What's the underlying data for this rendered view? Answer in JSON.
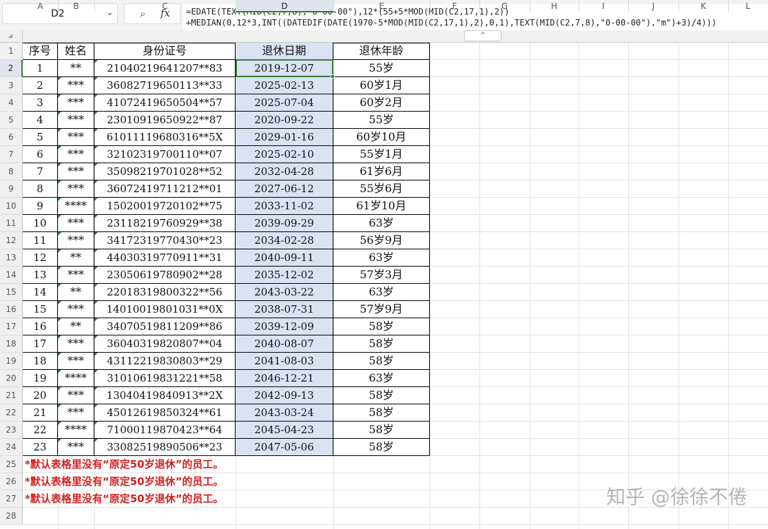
{
  "name_box": "D2",
  "formula_bar": {
    "zoom_icon": "zoom-search-icon",
    "fx_label": "fx",
    "line1": "=EDATE(TEXT(MID(C2,7,8),\"0-00-00\"),12*(55+5*MOD(MID(C2,17,1),2))",
    "line2": "+MEDIAN(0,12*3,INT((DATEDIF(DATE(1970-5*MOD(MID(C2,17,1),2),0,1),TEXT(MID(C2,7,8),\"0-00-00\"),\"m\")+3)/4)))"
  },
  "columns": [
    "A",
    "B",
    "C",
    "D",
    "E",
    "F",
    "G",
    "H",
    "I",
    "J",
    "K",
    "L"
  ],
  "selected_column": "D",
  "selected_row": 2,
  "collapse_label": "^",
  "headers": [
    "序号",
    "姓名",
    "身份证号",
    "退休日期",
    "退休年龄"
  ],
  "rows": [
    [
      "1",
      "**",
      "21040219641207**83",
      "2019-12-07",
      "55岁"
    ],
    [
      "2",
      "***",
      "36082719650113**33",
      "2025-02-13",
      "60岁1月"
    ],
    [
      "3",
      "***",
      "41072419650504**57",
      "2025-07-04",
      "60岁2月"
    ],
    [
      "4",
      "***",
      "23010919650922**87",
      "2020-09-22",
      "55岁"
    ],
    [
      "5",
      "***",
      "61011119680316**5X",
      "2029-01-16",
      "60岁10月"
    ],
    [
      "6",
      "***",
      "32102319700110**07",
      "2025-02-10",
      "55岁1月"
    ],
    [
      "7",
      "***",
      "35098219701028**52",
      "2032-04-28",
      "61岁6月"
    ],
    [
      "8",
      "***",
      "36072419711212**01",
      "2027-06-12",
      "55岁6月"
    ],
    [
      "9",
      "****",
      "15020019720102**75",
      "2033-11-02",
      "61岁10月"
    ],
    [
      "10",
      "***",
      "23118219760929**38",
      "2039-09-29",
      "63岁"
    ],
    [
      "11",
      "***",
      "34172319770430**23",
      "2034-02-28",
      "56岁9月"
    ],
    [
      "12",
      "**",
      "44030319770911**31",
      "2040-09-11",
      "63岁"
    ],
    [
      "13",
      "***",
      "23050619780902**28",
      "2035-12-02",
      "57岁3月"
    ],
    [
      "14",
      "**",
      "22018319800322**56",
      "2043-03-22",
      "63岁"
    ],
    [
      "15",
      "***",
      "14010019801031**0X",
      "2038-07-31",
      "57岁9月"
    ],
    [
      "16",
      "**",
      "34070519811209**86",
      "2039-12-09",
      "58岁"
    ],
    [
      "17",
      "***",
      "36040319820807**04",
      "2040-08-07",
      "58岁"
    ],
    [
      "18",
      "***",
      "43112219830803**29",
      "2041-08-03",
      "58岁"
    ],
    [
      "19",
      "****",
      "31010619831221**58",
      "2046-12-21",
      "63岁"
    ],
    [
      "20",
      "***",
      "13040419840913**2X",
      "2042-09-13",
      "58岁"
    ],
    [
      "21",
      "***",
      "45012619850324**61",
      "2043-03-24",
      "58岁"
    ],
    [
      "22",
      "****",
      "71000119870423**64",
      "2045-04-23",
      "58岁"
    ],
    [
      "23",
      "***",
      "33082519890506**23",
      "2047-05-06",
      "58岁"
    ]
  ],
  "notes": [
    "*默认表格里没有“原定50岁退休”的员工。",
    "*默认表格里没有“原定50岁退休”的员工。",
    "*默认表格里没有“原定50岁退休”的员工。"
  ],
  "row_numbers": [
    "1",
    "2",
    "3",
    "4",
    "5",
    "6",
    "7",
    "8",
    "9",
    "10",
    "11",
    "12",
    "13",
    "14",
    "15",
    "16",
    "17",
    "18",
    "19",
    "20",
    "21",
    "22",
    "23",
    "24",
    "25",
    "26",
    "27",
    "28"
  ],
  "watermark": "知乎 @徐徐不倦",
  "colors": {
    "selection": "#2e7d32",
    "date_fill": "#dbe2f4",
    "note": "#d21f1f"
  }
}
